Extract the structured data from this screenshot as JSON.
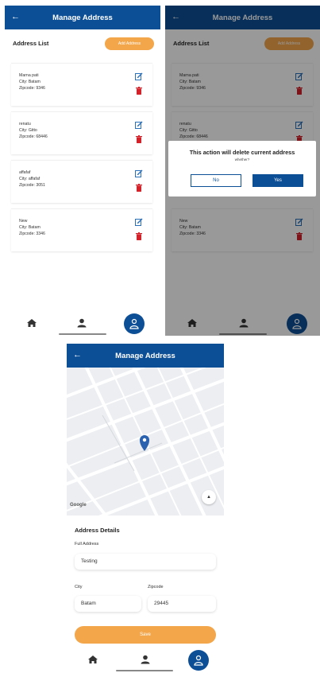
{
  "app": {
    "title": "Manage Address",
    "back_icon": "arrow-left-icon",
    "colors": {
      "primary": "#0d4f96",
      "accent": "#f3a64a",
      "delete": "#d3222a"
    }
  },
  "list_screen": {
    "list_title": "Address List",
    "add_button": "Add Address",
    "addresses": [
      {
        "line1": "Marna pati",
        "line2": "City: Batam",
        "line3": "Zipcode: 9346"
      },
      {
        "line1": "renatu",
        "line2": "City: Gitto",
        "line3": "Zipcode: 68446"
      },
      {
        "line1": "affafaf",
        "line2": "City: affafaf",
        "line3": "Zipcode: 3051"
      },
      {
        "line1": "New",
        "line2": "City: Batam",
        "line3": "Zipcode: 3346"
      }
    ]
  },
  "dialog": {
    "title": "This action will delete current address",
    "subtitle": "whether?",
    "no_label": "No",
    "yes_label": "Yes"
  },
  "bottom_nav": [
    {
      "icon": "home-icon"
    },
    {
      "icon": "user-icon"
    },
    {
      "icon": "profile-icon",
      "active": true
    }
  ],
  "details_screen": {
    "map_attribution": "Google",
    "section_title": "Address Details",
    "full_address_label": "Full Address",
    "full_address_value": "Testing",
    "city_label": "City",
    "city_value": "Batam",
    "zipcode_label": "Zipcode",
    "zipcode_value": "29445",
    "save_button": "Save"
  }
}
